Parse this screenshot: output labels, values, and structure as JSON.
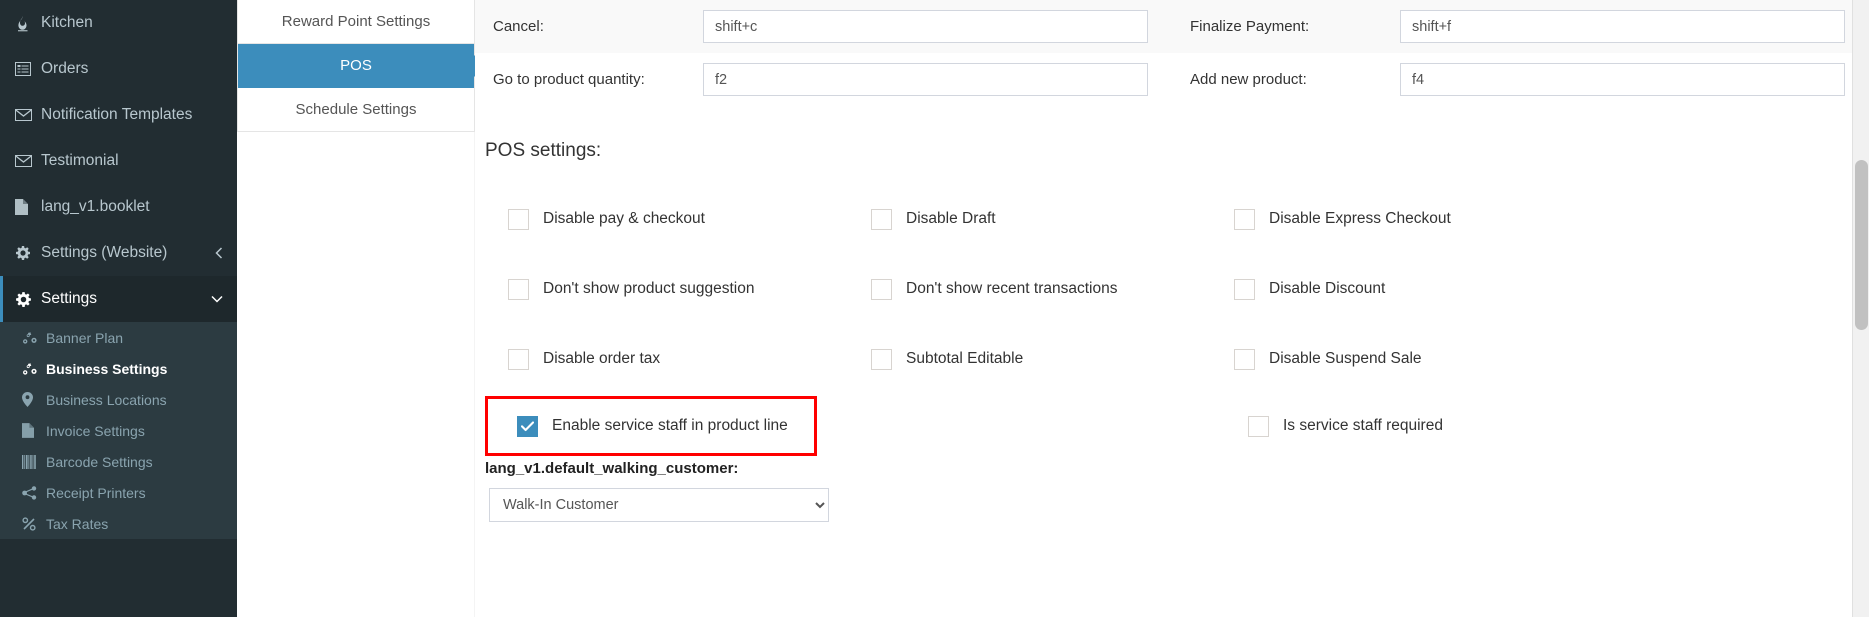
{
  "sidebar": {
    "items": [
      {
        "label": "Kitchen",
        "icon": "fire-icon",
        "state": "normal"
      },
      {
        "label": "Orders",
        "icon": "list-alt-icon",
        "state": "normal"
      },
      {
        "label": "Notification Templates",
        "icon": "envelope-icon",
        "state": "normal"
      },
      {
        "label": "Testimonial",
        "icon": "envelope-icon",
        "state": "normal"
      },
      {
        "label": "lang_v1.booklet",
        "icon": "file-icon",
        "state": "normal"
      },
      {
        "label": "Settings (Website)",
        "icon": "gear-icon",
        "state": "normal",
        "caret": "chevron-left-icon"
      },
      {
        "label": "Settings",
        "icon": "gear-icon",
        "state": "active",
        "caret": "chevron-down-icon"
      }
    ],
    "subitems": [
      {
        "label": "Banner Plan",
        "icon": "cogs-icon",
        "state": "normal"
      },
      {
        "label": "Business Settings",
        "icon": "cogs-icon",
        "state": "active"
      },
      {
        "label": "Business Locations",
        "icon": "map-marker-icon",
        "state": "normal"
      },
      {
        "label": "Invoice Settings",
        "icon": "file-icon",
        "state": "normal"
      },
      {
        "label": "Barcode Settings",
        "icon": "barcode-icon",
        "state": "normal"
      },
      {
        "label": "Receipt Printers",
        "icon": "share-alt-icon",
        "state": "normal"
      },
      {
        "label": "Tax Rates",
        "icon": "percent-icon",
        "state": "normal"
      }
    ]
  },
  "tabs": [
    {
      "label": "Reward Point Settings",
      "state": "normal"
    },
    {
      "label": "POS",
      "state": "active"
    },
    {
      "label": "Schedule Settings",
      "state": "normal"
    }
  ],
  "shortcuts": {
    "left": [
      {
        "label": "Cancel:",
        "value": "shift+c",
        "striped": true
      },
      {
        "label": "Go to product quantity:",
        "value": "f2",
        "striped": false
      }
    ],
    "right": [
      {
        "label": "Finalize Payment:",
        "value": "shift+f",
        "striped": true
      },
      {
        "label": "Add new product:",
        "value": "f4",
        "striped": false
      }
    ]
  },
  "pos_settings": {
    "heading": "POS settings:",
    "rows": [
      [
        {
          "label": "Disable pay & checkout",
          "checked": false
        },
        {
          "label": "Disable Draft",
          "checked": false
        },
        {
          "label": "Disable Express Checkout",
          "checked": false
        }
      ],
      [
        {
          "label": "Don't show product suggestion",
          "checked": false
        },
        {
          "label": "Don't show recent transactions",
          "checked": false
        },
        {
          "label": "Disable Discount",
          "checked": false
        }
      ],
      [
        {
          "label": "Disable order tax",
          "checked": false
        },
        {
          "label": "Subtotal Editable",
          "checked": false
        },
        {
          "label": "Disable Suspend Sale",
          "checked": false
        }
      ]
    ],
    "highlighted": {
      "label": "Enable service staff in product line",
      "checked": true
    },
    "service_staff_required": {
      "label": "Is service staff required",
      "checked": false
    },
    "highlight_color": "#ff0000",
    "accent_color": "#3c8dbc"
  },
  "default_customer": {
    "label": "lang_v1.default_walking_customer:",
    "selected": "Walk-In Customer",
    "options": [
      "Walk-In Customer"
    ]
  }
}
